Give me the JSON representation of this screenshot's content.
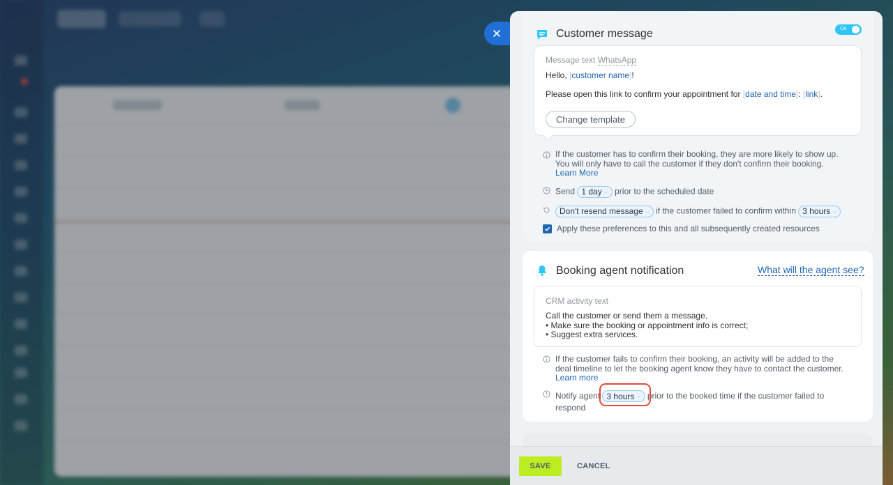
{
  "customer_message": {
    "title": "Customer message",
    "toggle_label": "On",
    "message_label_prefix": "Message text ",
    "message_label_channel": "WhatsApp",
    "line1_prefix": "Hello, ",
    "line1_token": "customer name",
    "line1_suffix": "!",
    "line2_prefix": "Please open this link to confirm your appointment for ",
    "line2_token1": "date and time",
    "line2_sep": ": ",
    "line2_token2": "link",
    "line2_suffix": ".",
    "change_template": "Change template",
    "info_line1": "If the customer has to confirm their booking, they are more likely to show up.",
    "info_line2": "You will only have to call the customer if they don't confirm their booking.",
    "learn_more": "Learn More",
    "send_prefix": "Send",
    "send_value": "1 day",
    "send_suffix": "prior to the scheduled date",
    "resend_value": "Don't resend message",
    "resend_middle": "if the customer failed to confirm within",
    "resend_hours": "3 hours",
    "apply_text": "Apply these preferences to this and all subsequently created resources"
  },
  "agent_notification": {
    "title": "Booking agent notification",
    "what_link": "What will the agent see?",
    "crm_label": "CRM activity text",
    "crm_line1": "Call the customer or send them a message.",
    "crm_line2": "• Make sure the booking or appointment info is correct;",
    "crm_line3": "• Suggest extra services.",
    "info_line1": "If the customer fails to confirm their booking, an activity will be added to the",
    "info_line2": "deal timeline to let the booking agent know they have to contact the customer.",
    "learn_more": "Learn more",
    "notify_prefix": "Notify agent",
    "notify_value": "3 hours",
    "notify_suffix": "prior to the booked time if the customer failed to",
    "notify_suffix2": "respond"
  },
  "footer": {
    "save": "SAVE",
    "cancel": "CANCEL"
  },
  "colors": {
    "accent": "#2066b0",
    "toggle": "#2fc6f6",
    "save": "#bbed21",
    "highlight": "#e2483d"
  }
}
